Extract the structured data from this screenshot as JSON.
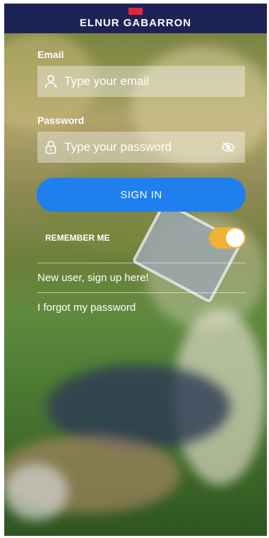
{
  "header": {
    "brand": "ELNUR GABARRON"
  },
  "email": {
    "label": "Email",
    "placeholder": "Type your email"
  },
  "password": {
    "label": "Password",
    "placeholder": "Type your password"
  },
  "signin": {
    "label": "SIGN IN"
  },
  "remember": {
    "label": "REMEMBER ME",
    "enabled": true
  },
  "links": {
    "signup": "New user, sign up here!",
    "forgot": "I forgot my password"
  },
  "colors": {
    "header_bg": "#1d2354",
    "brand_red": "#e2243c",
    "button_blue": "#1f7fef",
    "toggle_on": "#f0b22f"
  },
  "icons": {
    "email": "user-icon",
    "password": "lock-icon",
    "visibility": "eye-off-icon"
  }
}
